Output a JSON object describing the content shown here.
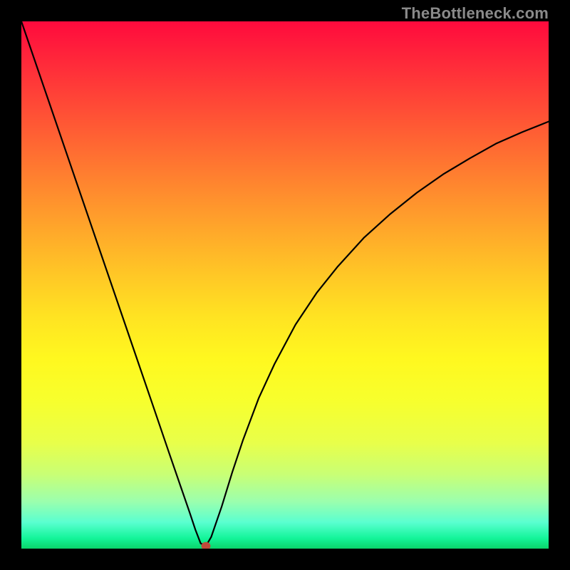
{
  "watermark": "TheBottleneck.com",
  "chart_data": {
    "type": "line",
    "title": "",
    "xlabel": "",
    "ylabel": "",
    "xlim": [
      0,
      100
    ],
    "ylim": [
      0,
      100
    ],
    "grid": false,
    "legend": false,
    "series": [
      {
        "name": "curve",
        "x": [
          0,
          5,
          10,
          15,
          20,
          25,
          28,
          30,
          32,
          33,
          34,
          35,
          36,
          38,
          40,
          42,
          45,
          48,
          52,
          56,
          60,
          65,
          70,
          75,
          80,
          85,
          90,
          95,
          100
        ],
        "y": [
          100,
          85.4,
          70.8,
          56.2,
          41.6,
          27.0,
          18.2,
          12.4,
          6.6,
          3.6,
          1.0,
          0.5,
          2.2,
          8.0,
          14.5,
          20.5,
          28.5,
          35.0,
          42.5,
          48.5,
          53.5,
          59.0,
          63.5,
          67.5,
          71.0,
          74.0,
          76.8,
          79.0,
          81.0
        ]
      }
    ],
    "marker": {
      "x": 35,
      "y": 0.5
    }
  },
  "colors": {
    "gradient_top": "#ff0a3d",
    "gradient_bottom": "#0ad46a",
    "curve": "#000000",
    "marker": "#c04a3a",
    "frame": "#000000",
    "watermark": "#8a8a8a"
  }
}
